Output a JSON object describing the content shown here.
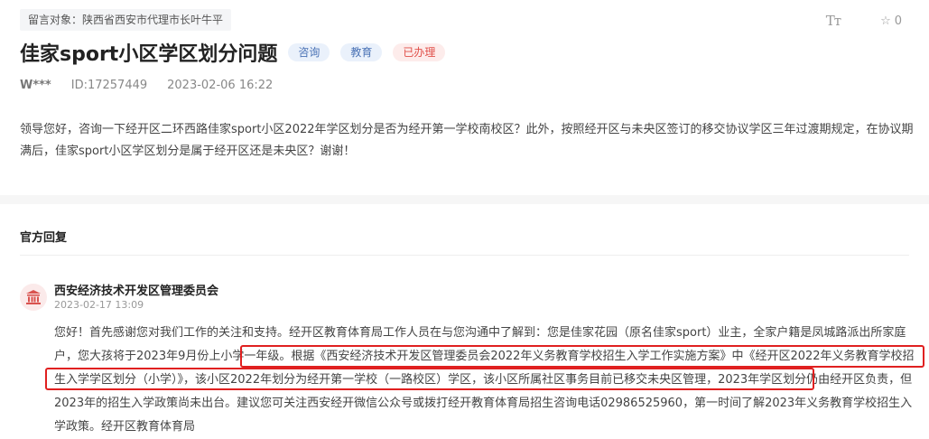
{
  "message": {
    "target_label": "留言对象：陕西省西安市代理市长叶牛平",
    "title": "佳家sport小区学区划分问题",
    "tags": [
      {
        "label": "咨询",
        "color": "#4a72b5"
      },
      {
        "label": "教育",
        "color": "#4a72b5"
      },
      {
        "label": "已办理",
        "color": "#e0504a"
      }
    ],
    "author": "W***",
    "id_text": "ID:17257449",
    "datetime": "2023-02-06 16:22",
    "content": "领导您好，咨询一下经开区二环西路佳家sport小区2022年学区划分是否为经开第一学校南校区？此外，按照经开区与未央区签订的移交协议学区三年过渡期规定，在协议期满后，佳家sport小区学区划分是属于经开区还是未央区？谢谢！"
  },
  "toolbar": {
    "font_size_icon": "font-size-icon",
    "font_size_glyph": "Tт",
    "favorite_icon": "star-icon",
    "favorite_count": "0"
  },
  "reply": {
    "section_title": "官方回复",
    "org_icon": "government-building-icon",
    "org_name": "西安经济技术开发区管理委员会",
    "date": "2023-02-17 13:09",
    "body": "您好！首先感谢您对我们工作的关注和支持。经开区教育体育局工作人员在与您沟通中了解到：您是佳家花园（原名佳家sport）业主，全家户籍是凤城路派出所家庭户，您大孩将于2023年9月份上小学一年级。根据《西安经济技术开发区管理委员会2022年义务教育学校招生入学工作实施方案》中《经开区2022年义务教育学校招生入学学区划分（小学）》，该小区2022年划分为经开第一学校（一路校区）学区，该小区所属社区事务目前已移交未央区管理，2023年学区划分仍由经开区负责，但2023年的招生入学政策尚未出台。建议您可关注西安经开微信公众号或拨打经开教育体育局招生咨询电话02986525960，第一时间了解2023年义务教育学校招生入学政策。经开区教育体育局",
    "highlight_color": "#e02020"
  }
}
